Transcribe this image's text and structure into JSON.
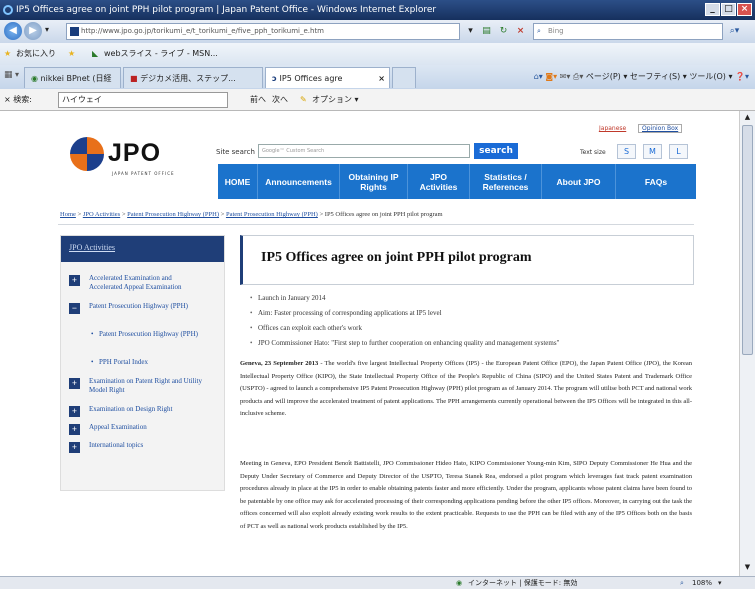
{
  "window": {
    "title": "IP5 Offices agree on joint PPH pilot program | Japan Patent Office - Windows Internet Explorer",
    "min": "_",
    "max": "□",
    "close": "×"
  },
  "addressbar": {
    "url": "http://www.jpo.go.jp/torikumi_e/t_torikumi_e/five_pph_torikumi_e.htm",
    "search_placeholder": "Bing"
  },
  "favorites": {
    "label": "お気に入り",
    "items": [
      "nikkei BPnet (日経",
      "webスライス - ライブ - MSN..."
    ]
  },
  "tabs": {
    "items": [
      "nikkei BPnet (日経",
      "デジカメ活用、ステップ...",
      "IP5 Offices agre"
    ],
    "tools": "ページ(P) ▾  セーフティ(S) ▾  ツール(O) ▾"
  },
  "searchbar": {
    "label": "× 検索:",
    "value": "ハイウェイ",
    "prev": "前へ",
    "next": "次へ",
    "options": "オプション ▾"
  },
  "header": {
    "logo_text": "JPO",
    "logo_sub": "JAPAN PATENT OFFICE",
    "japanese_link": "Japanese",
    "opinion_link": "Opinion Box",
    "site_search_label": "Site search",
    "site_search_placeholder": "Google™ Custom Search",
    "search_button": "search",
    "text_size_label": "Text size",
    "text_sizes": [
      "S",
      "M",
      "L"
    ]
  },
  "nav": [
    "HOME",
    "Announcements",
    "Obtaining IP Rights",
    "JPO Activities",
    "Statistics / References",
    "About JPO",
    "FAQs"
  ],
  "breadcrumb": {
    "items": [
      "Home",
      "JPO Activities",
      "Patent Prosecution Highway (PPH)",
      "Patent Prosecution Highway (PPH)"
    ],
    "current": "IP5 Offices agree on joint PPH pilot program"
  },
  "sidebar": {
    "heading": "JPO Activities",
    "items": [
      {
        "label": "Accelerated Examination and Accelerated Appeal Examination",
        "icon": "+"
      },
      {
        "label": "Patent Prosecution Highway (PPH)",
        "icon": "−"
      },
      {
        "label": "Patent Prosecution Highway (PPH)",
        "icon": "•"
      },
      {
        "label": "PPH Portal Index",
        "icon": "•"
      },
      {
        "label": "Examination on Patent Right and Utility Model Right",
        "icon": "+"
      },
      {
        "label": "Examination on Design Right",
        "icon": "+"
      },
      {
        "label": "Appeal Examination",
        "icon": "+"
      },
      {
        "label": "International topics",
        "icon": "+"
      }
    ]
  },
  "article": {
    "title": "IP5 Offices agree on joint PPH pilot program",
    "bullets": [
      "Launch in January 2014",
      "Aim: Faster processing of corresponding applications at IP5 level",
      "Offices can exploit each other's work",
      "JPO Commissioner Hato: \"First step to further cooperation on enhancing quality and management systems\""
    ],
    "para1_lead": "Geneva, 23 September 2013",
    "para1": " - The world's five largest Intellectual Property Offices (IP5) - the European Patent Office (EPO), the Japan Patent Office (JPO), the Korean Intellectual Property Office (KIPO), the State Intellectual Property Office of the People's Republic of China (SIPO) and the United States Patent and Trademark Office (USPTO) - agreed to launch a comprehensive IP5 Patent Prosecution Highway (PPH) pilot program as of January 2014. The program will utilise both PCT and national work products and will improve the accelerated treatment of patent applications. The PPH arrangements currently operational between the IP5 Offices will be integrated in this all-inclusive scheme.",
    "para2": "Meeting in Geneva, EPO President Benoît Battistelli, JPO Commissioner Hideo Hato, KIPO Commissioner Young-min Kim, SIPO Deputy Commissioner He Hua and the Deputy Under Secretary of Commerce and Deputy Director of the USPTO, Teresa Stanek Rea, endorsed a pilot program which leverages fast track patent examination procedures already in place at the IP5 in order to enable obtaining patents faster and more efficiently. Under the program, applicants whose patent claims have been found to be patentable by one office may ask for accelerated processing of their corresponding applications pending before the other IP5 offices. Moreover, in carrying out the task the offices concerned will also exploit already existing work results to the extent practicable. Requests to use the PPH can be filed with any of the IP5 Offices both on the basis of PCT as well as national work products established by the IP5."
  },
  "statusbar": {
    "zone": "インターネット | 保護モード: 無効",
    "zoom": "108%"
  }
}
